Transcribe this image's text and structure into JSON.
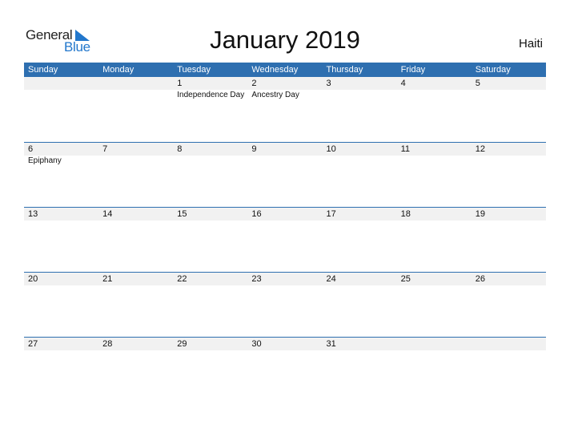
{
  "logo": {
    "line1": "General",
    "line2": "Blue"
  },
  "title": "January 2019",
  "country": "Haiti",
  "colors": {
    "header": "#2e6fb0",
    "band": "#f1f1f1",
    "brand": "#2277cc"
  },
  "weekdays": [
    "Sunday",
    "Monday",
    "Tuesday",
    "Wednesday",
    "Thursday",
    "Friday",
    "Saturday"
  ],
  "weeks": [
    {
      "days": [
        "",
        "",
        "1",
        "2",
        "3",
        "4",
        "5"
      ],
      "events": [
        "",
        "",
        "Independence Day",
        "Ancestry Day",
        "",
        "",
        ""
      ]
    },
    {
      "days": [
        "6",
        "7",
        "8",
        "9",
        "10",
        "11",
        "12"
      ],
      "events": [
        "Epiphany",
        "",
        "",
        "",
        "",
        "",
        ""
      ]
    },
    {
      "days": [
        "13",
        "14",
        "15",
        "16",
        "17",
        "18",
        "19"
      ],
      "events": [
        "",
        "",
        "",
        "",
        "",
        "",
        ""
      ]
    },
    {
      "days": [
        "20",
        "21",
        "22",
        "23",
        "24",
        "25",
        "26"
      ],
      "events": [
        "",
        "",
        "",
        "",
        "",
        "",
        ""
      ]
    },
    {
      "days": [
        "27",
        "28",
        "29",
        "30",
        "31",
        "",
        ""
      ],
      "events": [
        "",
        "",
        "",
        "",
        "",
        "",
        ""
      ]
    }
  ]
}
